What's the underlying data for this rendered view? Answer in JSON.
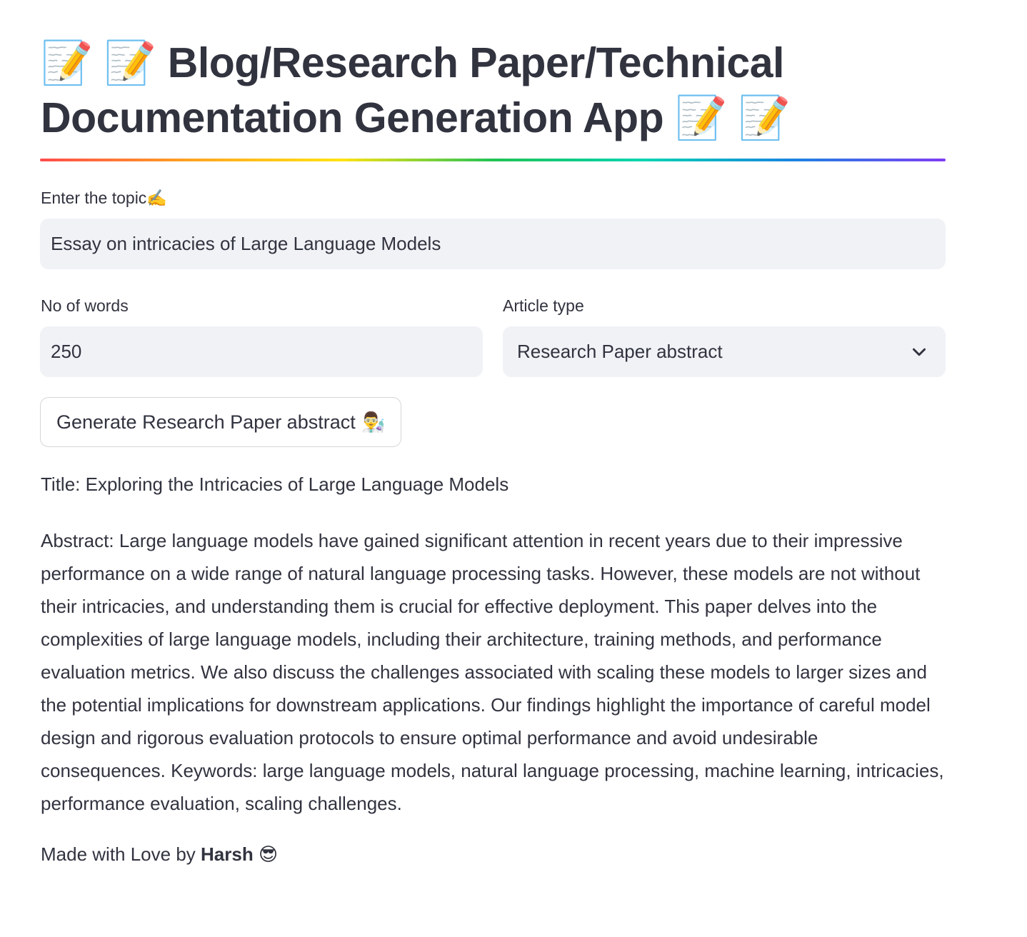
{
  "header": {
    "title_prefix": "📝 📝",
    "title_main": "Blog/Research Paper/Technical Documentation Generation App",
    "title_suffix": "📝 📝"
  },
  "topic": {
    "label": "Enter the topic✍️",
    "value": "Essay on intricacies of Large Language Models"
  },
  "words": {
    "label": "No of words",
    "value": "250"
  },
  "article_type": {
    "label": "Article type",
    "selected": "Research Paper abstract",
    "icon": "chevron-down-icon"
  },
  "generate_button": {
    "label": "Generate Research Paper abstract",
    "emoji": "👨‍🔬"
  },
  "output": {
    "title": "Title: Exploring the Intricacies of Large Language Models",
    "abstract": "Abstract: Large language models have gained significant attention in recent years due to their impressive performance on a wide range of natural language processing tasks. However, these models are not without their intricacies, and understanding them is crucial for effective deployment. This paper delves into the complexities of large language models, including their architecture, training methods, and performance evaluation metrics. We also discuss the challenges associated with scaling these models to larger sizes and the potential implications for downstream applications. Our findings highlight the importance of careful model design and rigorous evaluation protocols to ensure optimal performance and avoid undesirable consequences. Keywords: large language models, natural language processing, machine learning, intricacies, performance evaluation, scaling challenges."
  },
  "footer": {
    "prefix": "Made with Love by",
    "author": "Harsh",
    "emoji": "😎"
  },
  "colors": {
    "text": "#31333f",
    "input_background": "#f0f2f6",
    "button_border": "#d6d6d9",
    "divider_gradient": [
      "#ff4b4b",
      "#ffa421",
      "#ffe312",
      "#21c354",
      "#00d4b1",
      "#1c83e1",
      "#803df5"
    ]
  }
}
